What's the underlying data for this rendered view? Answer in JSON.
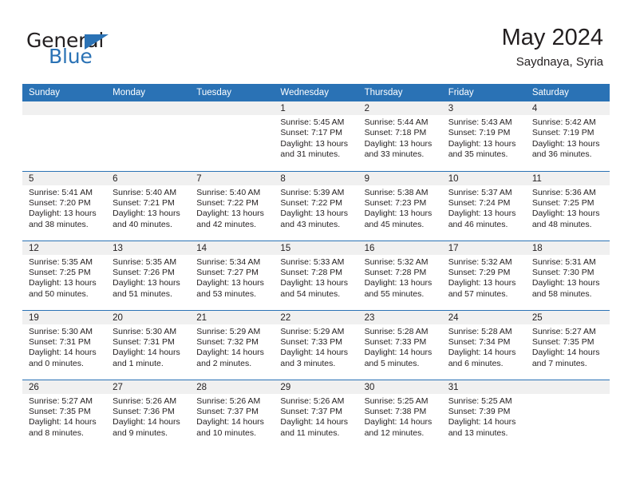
{
  "brand": {
    "name_top": "General",
    "name_bottom": "Blue",
    "accent_color": "#2a72b5"
  },
  "header": {
    "title": "May 2024",
    "subtitle": "Saydnaya, Syria"
  },
  "calendar": {
    "weekday_headers": [
      "Sunday",
      "Monday",
      "Tuesday",
      "Wednesday",
      "Thursday",
      "Friday",
      "Saturday"
    ],
    "header_bg": "#2a72b5",
    "header_text_color": "#ffffff",
    "daynum_bg": "#f0f0f0",
    "weeks": [
      [
        {
          "day": "",
          "empty": true
        },
        {
          "day": "",
          "empty": true
        },
        {
          "day": "",
          "empty": true
        },
        {
          "day": "1",
          "sunrise": "Sunrise: 5:45 AM",
          "sunset": "Sunset: 7:17 PM",
          "daylight": "Daylight: 13 hours and 31 minutes."
        },
        {
          "day": "2",
          "sunrise": "Sunrise: 5:44 AM",
          "sunset": "Sunset: 7:18 PM",
          "daylight": "Daylight: 13 hours and 33 minutes."
        },
        {
          "day": "3",
          "sunrise": "Sunrise: 5:43 AM",
          "sunset": "Sunset: 7:19 PM",
          "daylight": "Daylight: 13 hours and 35 minutes."
        },
        {
          "day": "4",
          "sunrise": "Sunrise: 5:42 AM",
          "sunset": "Sunset: 7:19 PM",
          "daylight": "Daylight: 13 hours and 36 minutes."
        }
      ],
      [
        {
          "day": "5",
          "sunrise": "Sunrise: 5:41 AM",
          "sunset": "Sunset: 7:20 PM",
          "daylight": "Daylight: 13 hours and 38 minutes."
        },
        {
          "day": "6",
          "sunrise": "Sunrise: 5:40 AM",
          "sunset": "Sunset: 7:21 PM",
          "daylight": "Daylight: 13 hours and 40 minutes."
        },
        {
          "day": "7",
          "sunrise": "Sunrise: 5:40 AM",
          "sunset": "Sunset: 7:22 PM",
          "daylight": "Daylight: 13 hours and 42 minutes."
        },
        {
          "day": "8",
          "sunrise": "Sunrise: 5:39 AM",
          "sunset": "Sunset: 7:22 PM",
          "daylight": "Daylight: 13 hours and 43 minutes."
        },
        {
          "day": "9",
          "sunrise": "Sunrise: 5:38 AM",
          "sunset": "Sunset: 7:23 PM",
          "daylight": "Daylight: 13 hours and 45 minutes."
        },
        {
          "day": "10",
          "sunrise": "Sunrise: 5:37 AM",
          "sunset": "Sunset: 7:24 PM",
          "daylight": "Daylight: 13 hours and 46 minutes."
        },
        {
          "day": "11",
          "sunrise": "Sunrise: 5:36 AM",
          "sunset": "Sunset: 7:25 PM",
          "daylight": "Daylight: 13 hours and 48 minutes."
        }
      ],
      [
        {
          "day": "12",
          "sunrise": "Sunrise: 5:35 AM",
          "sunset": "Sunset: 7:25 PM",
          "daylight": "Daylight: 13 hours and 50 minutes."
        },
        {
          "day": "13",
          "sunrise": "Sunrise: 5:35 AM",
          "sunset": "Sunset: 7:26 PM",
          "daylight": "Daylight: 13 hours and 51 minutes."
        },
        {
          "day": "14",
          "sunrise": "Sunrise: 5:34 AM",
          "sunset": "Sunset: 7:27 PM",
          "daylight": "Daylight: 13 hours and 53 minutes."
        },
        {
          "day": "15",
          "sunrise": "Sunrise: 5:33 AM",
          "sunset": "Sunset: 7:28 PM",
          "daylight": "Daylight: 13 hours and 54 minutes."
        },
        {
          "day": "16",
          "sunrise": "Sunrise: 5:32 AM",
          "sunset": "Sunset: 7:28 PM",
          "daylight": "Daylight: 13 hours and 55 minutes."
        },
        {
          "day": "17",
          "sunrise": "Sunrise: 5:32 AM",
          "sunset": "Sunset: 7:29 PM",
          "daylight": "Daylight: 13 hours and 57 minutes."
        },
        {
          "day": "18",
          "sunrise": "Sunrise: 5:31 AM",
          "sunset": "Sunset: 7:30 PM",
          "daylight": "Daylight: 13 hours and 58 minutes."
        }
      ],
      [
        {
          "day": "19",
          "sunrise": "Sunrise: 5:30 AM",
          "sunset": "Sunset: 7:31 PM",
          "daylight": "Daylight: 14 hours and 0 minutes."
        },
        {
          "day": "20",
          "sunrise": "Sunrise: 5:30 AM",
          "sunset": "Sunset: 7:31 PM",
          "daylight": "Daylight: 14 hours and 1 minute."
        },
        {
          "day": "21",
          "sunrise": "Sunrise: 5:29 AM",
          "sunset": "Sunset: 7:32 PM",
          "daylight": "Daylight: 14 hours and 2 minutes."
        },
        {
          "day": "22",
          "sunrise": "Sunrise: 5:29 AM",
          "sunset": "Sunset: 7:33 PM",
          "daylight": "Daylight: 14 hours and 3 minutes."
        },
        {
          "day": "23",
          "sunrise": "Sunrise: 5:28 AM",
          "sunset": "Sunset: 7:33 PM",
          "daylight": "Daylight: 14 hours and 5 minutes."
        },
        {
          "day": "24",
          "sunrise": "Sunrise: 5:28 AM",
          "sunset": "Sunset: 7:34 PM",
          "daylight": "Daylight: 14 hours and 6 minutes."
        },
        {
          "day": "25",
          "sunrise": "Sunrise: 5:27 AM",
          "sunset": "Sunset: 7:35 PM",
          "daylight": "Daylight: 14 hours and 7 minutes."
        }
      ],
      [
        {
          "day": "26",
          "sunrise": "Sunrise: 5:27 AM",
          "sunset": "Sunset: 7:35 PM",
          "daylight": "Daylight: 14 hours and 8 minutes."
        },
        {
          "day": "27",
          "sunrise": "Sunrise: 5:26 AM",
          "sunset": "Sunset: 7:36 PM",
          "daylight": "Daylight: 14 hours and 9 minutes."
        },
        {
          "day": "28",
          "sunrise": "Sunrise: 5:26 AM",
          "sunset": "Sunset: 7:37 PM",
          "daylight": "Daylight: 14 hours and 10 minutes."
        },
        {
          "day": "29",
          "sunrise": "Sunrise: 5:26 AM",
          "sunset": "Sunset: 7:37 PM",
          "daylight": "Daylight: 14 hours and 11 minutes."
        },
        {
          "day": "30",
          "sunrise": "Sunrise: 5:25 AM",
          "sunset": "Sunset: 7:38 PM",
          "daylight": "Daylight: 14 hours and 12 minutes."
        },
        {
          "day": "31",
          "sunrise": "Sunrise: 5:25 AM",
          "sunset": "Sunset: 7:39 PM",
          "daylight": "Daylight: 14 hours and 13 minutes."
        },
        {
          "day": "",
          "empty": true
        }
      ]
    ]
  }
}
